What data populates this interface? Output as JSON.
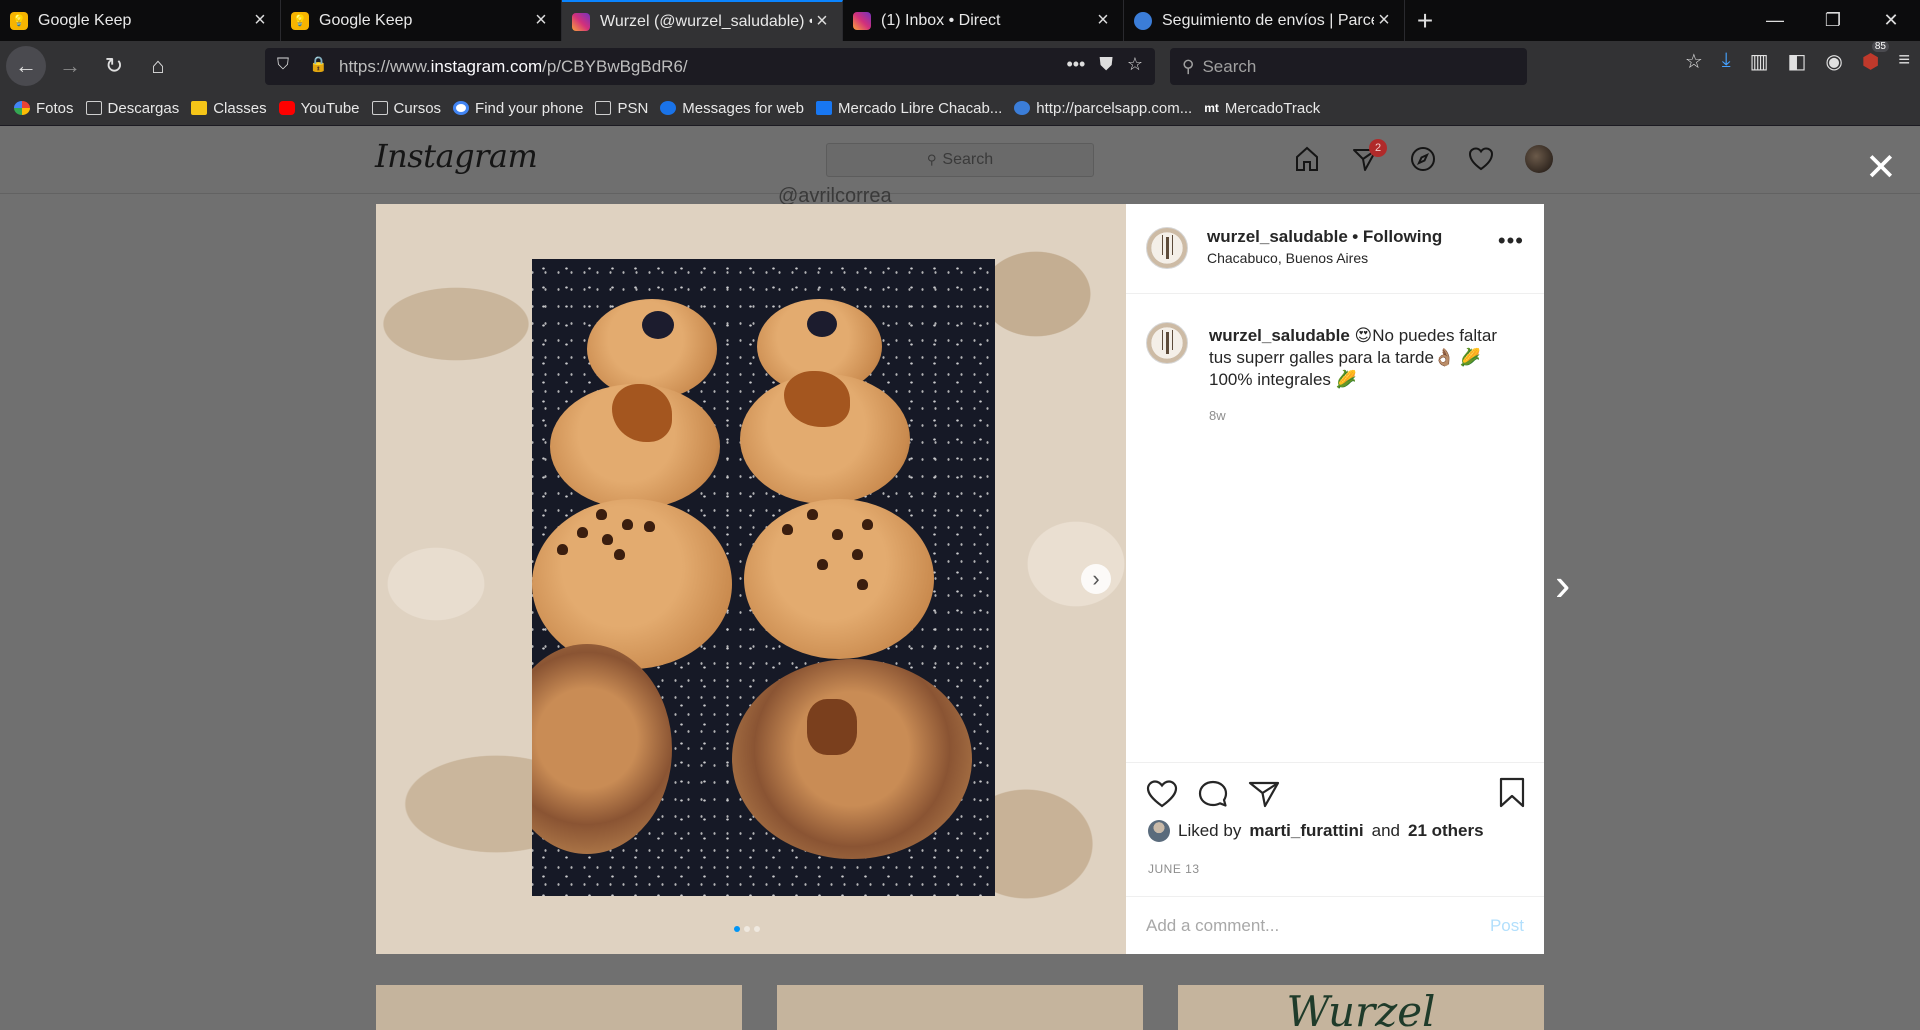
{
  "tabs": [
    {
      "title": "Google Keep",
      "icon": "keep-icon",
      "active": false
    },
    {
      "title": "Google Keep",
      "icon": "keep-icon",
      "active": false
    },
    {
      "title": "Wurzel (@wurzel_saludable) • I",
      "icon": "instagram-icon",
      "active": true
    },
    {
      "title": "(1) Inbox • Direct",
      "icon": "instagram-icon",
      "active": false
    },
    {
      "title": "Seguimiento de envíos | Parcels",
      "icon": "globe-icon",
      "active": false
    }
  ],
  "address": {
    "url_prefix": "https://www.",
    "url_domain": "instagram.com",
    "url_path": "/p/CBYBwBgBdR6/"
  },
  "search": {
    "placeholder": "Search"
  },
  "toolbar": {
    "ublock_count": "85"
  },
  "bookmarks": [
    {
      "label": "Fotos",
      "icon": "photos"
    },
    {
      "label": "Descargas",
      "icon": "folder"
    },
    {
      "label": "Classes",
      "icon": "classes"
    },
    {
      "label": "YouTube",
      "icon": "yt"
    },
    {
      "label": "Cursos",
      "icon": "folder"
    },
    {
      "label": "Find your phone",
      "icon": "g"
    },
    {
      "label": "PSN",
      "icon": "folder"
    },
    {
      "label": "Messages for web",
      "icon": "msg"
    },
    {
      "label": "Mercado Libre Chacab...",
      "icon": "fb"
    },
    {
      "label": "http://parcelsapp.com...",
      "icon": "globe"
    },
    {
      "label": "MercadoTrack",
      "icon": "mt"
    }
  ],
  "instagram": {
    "logo": "Instagram",
    "search_placeholder": "Search",
    "direct_badge": "2",
    "background_mention": "@avrilcorrea"
  },
  "post": {
    "username": "wurzel_saludable",
    "follow_status": "• Following",
    "location": "Chacabuco, Buenos Aires",
    "more": "•••",
    "caption_user": "wurzel_saludable",
    "caption_text": "😍No puedes faltar tus superr galles para la tarde👌🏽 🌽 100% integrales 🌽",
    "time_ago": "8w",
    "liked_prefix": "Liked by",
    "liked_user": "marti_furattini",
    "liked_and": "and",
    "liked_others": "21 others",
    "date": "JUNE 13",
    "comment_placeholder": "Add a comment...",
    "post_button": "Post",
    "carousel_pages": 3,
    "carousel_current": 1
  },
  "grid_thumb_text": "Wurzel",
  "colors": {
    "accent_blue": "#0095f6",
    "post_disabled": "#b2dffc",
    "badge_red": "#b02a2a",
    "firefox_accent": "#0a84ff"
  }
}
